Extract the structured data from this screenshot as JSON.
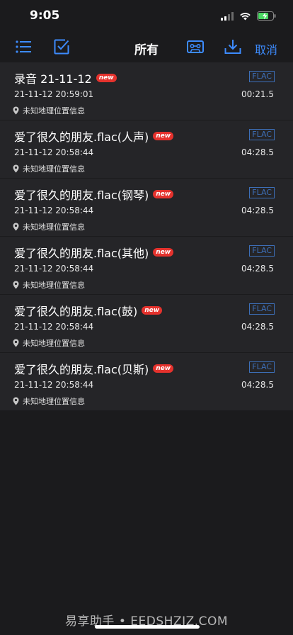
{
  "status_bar": {
    "time": "9:05"
  },
  "toolbar": {
    "title": "所有",
    "cancel_label": "取消"
  },
  "recordings": [
    {
      "title": "录音 21-11-12",
      "badge": "new",
      "format": "FLAC",
      "date": "21-11-12 20:59:01",
      "duration": "00:21.5",
      "location": "未知地理位置信息"
    },
    {
      "title": "爱了很久的朋友.flac(人声)",
      "badge": "new",
      "format": "FLAC",
      "date": "21-11-12 20:58:44",
      "duration": "04:28.5",
      "location": "未知地理位置信息"
    },
    {
      "title": "爱了很久的朋友.flac(钢琴)",
      "badge": "new",
      "format": "FLAC",
      "date": "21-11-12 20:58:44",
      "duration": "04:28.5",
      "location": "未知地理位置信息"
    },
    {
      "title": "爱了很久的朋友.flac(其他)",
      "badge": "new",
      "format": "FLAC",
      "date": "21-11-12 20:58:44",
      "duration": "04:28.5",
      "location": "未知地理位置信息"
    },
    {
      "title": "爱了很久的朋友.flac(鼓)",
      "badge": "new",
      "format": "FLAC",
      "date": "21-11-12 20:58:44",
      "duration": "04:28.5",
      "location": "未知地理位置信息"
    },
    {
      "title": "爱了很久的朋友.flac(贝斯)",
      "badge": "new",
      "format": "FLAC",
      "date": "21-11-12 20:58:44",
      "duration": "04:28.5",
      "location": "未知地理位置信息"
    }
  ],
  "watermark": "易享助手 • EEDSHZJZ.COM",
  "colors": {
    "accent": "#3d8bfd",
    "background": "#1b1b1d",
    "row_background": "#252528",
    "badge_new": "#e5322d",
    "format_badge": "#3d6fb8",
    "battery_fill": "#4cd964"
  }
}
